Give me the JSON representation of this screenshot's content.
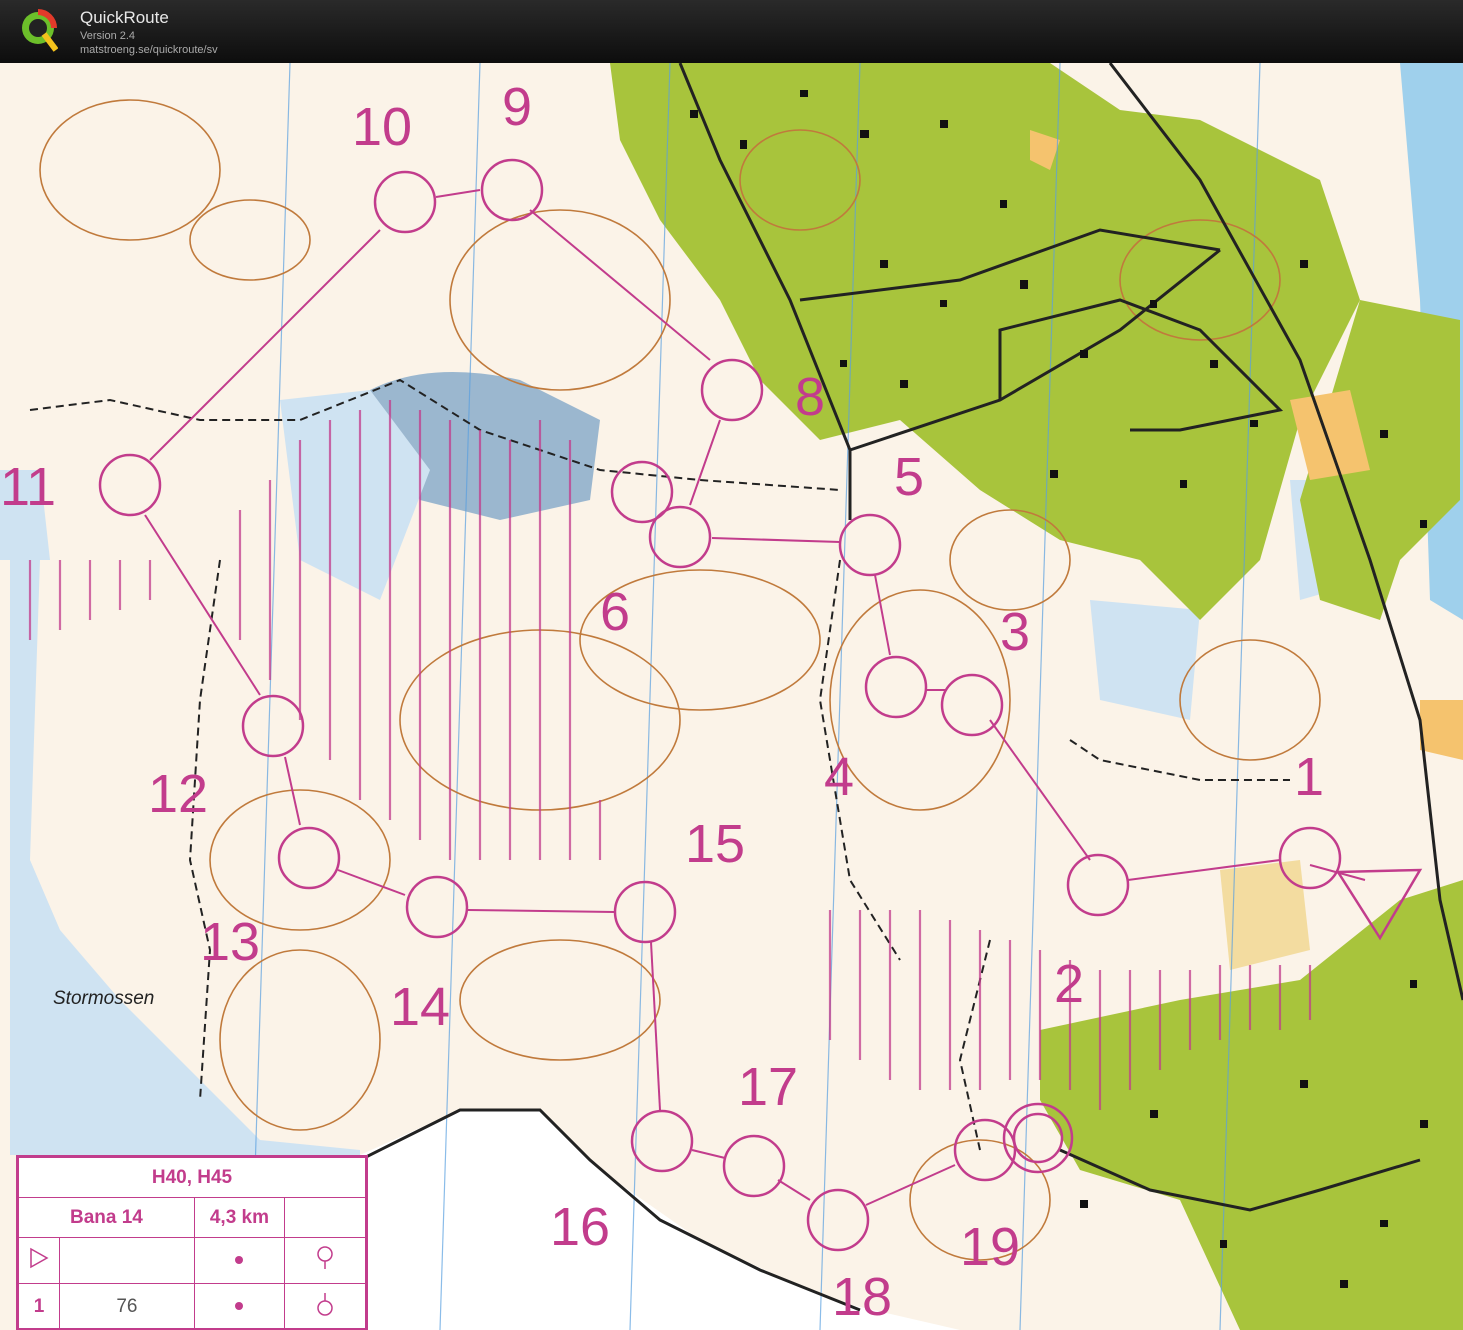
{
  "app": {
    "name": "QuickRoute",
    "version": "Version 2.4",
    "url": "matstroeng.se/quickroute/sv",
    "logo_letter": "Q"
  },
  "map": {
    "place_name": "Stormossen",
    "controls": [
      "1",
      "2",
      "3",
      "4",
      "5",
      "6",
      "8",
      "9",
      "10",
      "11",
      "12",
      "13",
      "14",
      "15",
      "16",
      "17",
      "18",
      "19"
    ],
    "colors": {
      "course": "#c23c8c",
      "contour": "#c07a3c",
      "forest_green": "#a8c43c",
      "water_blue": "#cfe3f2",
      "open_yellow": "#f5c36e",
      "background": "#fbf3e8"
    }
  },
  "legend": {
    "classes": "H40, H45",
    "course": "Bana 14",
    "length": "4,3 km",
    "first_control_no": "1",
    "first_control_code": "76"
  }
}
